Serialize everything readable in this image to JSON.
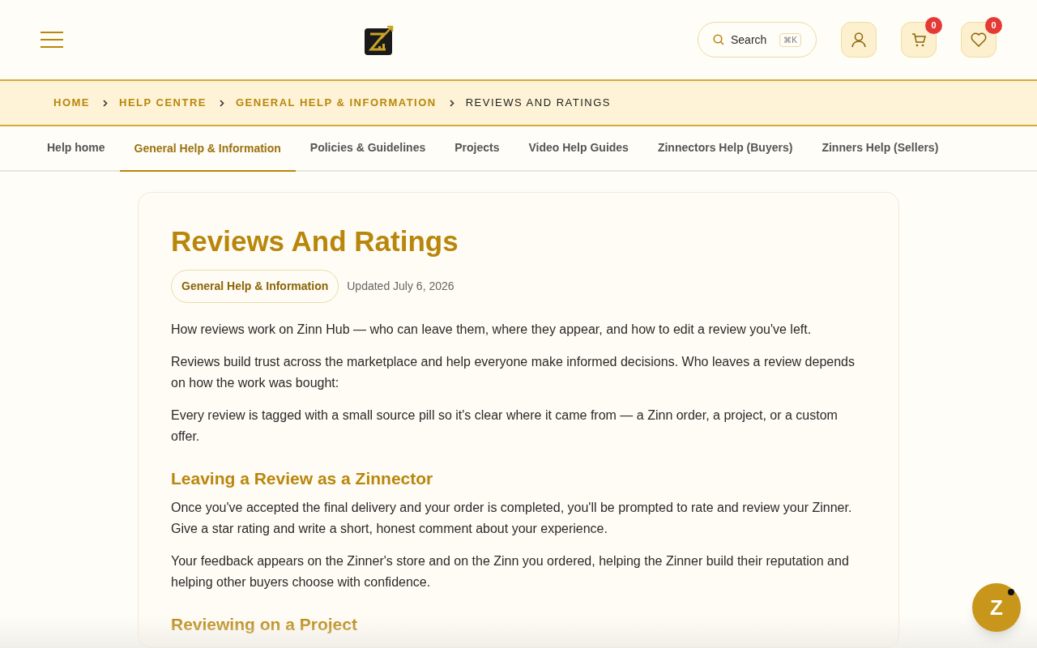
{
  "header": {
    "search": {
      "label": "Search",
      "shortcut": "⌘K"
    },
    "cart_count": "0",
    "wishlist_count": "0"
  },
  "breadcrumb": [
    {
      "label": "HOME",
      "current": false
    },
    {
      "label": "HELP CENTRE",
      "current": false
    },
    {
      "label": "GENERAL HELP & INFORMATION",
      "current": false
    },
    {
      "label": "REVIEWS AND RATINGS",
      "current": true
    }
  ],
  "tabs": [
    {
      "label": "Help home",
      "selected": false
    },
    {
      "label": "General Help & Information",
      "selected": true
    },
    {
      "label": "Policies & Guidelines",
      "selected": false
    },
    {
      "label": "Projects",
      "selected": false
    },
    {
      "label": "Video Help Guides",
      "selected": false
    },
    {
      "label": "Zinnectors Help (Buyers)",
      "selected": false
    },
    {
      "label": "Zinners Help (Sellers)",
      "selected": false
    }
  ],
  "article": {
    "title": "Reviews And Ratings",
    "category": "General Help & Information",
    "updated": "Updated July 6, 2026",
    "blocks": [
      {
        "kind": "paragraph",
        "text": "How reviews work on Zinn Hub — who can leave them, where they appear, and how to edit a review you've left."
      },
      {
        "kind": "paragraph",
        "text": "Reviews build trust across the marketplace and help everyone make informed decisions. Who leaves a review depends on how the work was bought:"
      },
      {
        "kind": "paragraph",
        "text": "Every review is tagged with a small source pill so it's clear where it came from — a Zinn order, a project, or a custom offer."
      },
      {
        "kind": "heading",
        "text": "Leaving a Review as a Zinnector"
      },
      {
        "kind": "paragraph",
        "text": "Once you've accepted the final delivery and your order is completed, you'll be prompted to rate and review your Zinner. Give a star rating and write a short, honest comment about your experience."
      },
      {
        "kind": "paragraph",
        "text": "Your feedback appears on the Zinner's store and on the Zinn you ordered, helping the Zinner build their reputation and helping other buyers choose with confidence."
      },
      {
        "kind": "heading",
        "text": "Reviewing on a Project"
      }
    ]
  },
  "chat_button": {
    "label": "Z",
    "unread": true
  }
}
